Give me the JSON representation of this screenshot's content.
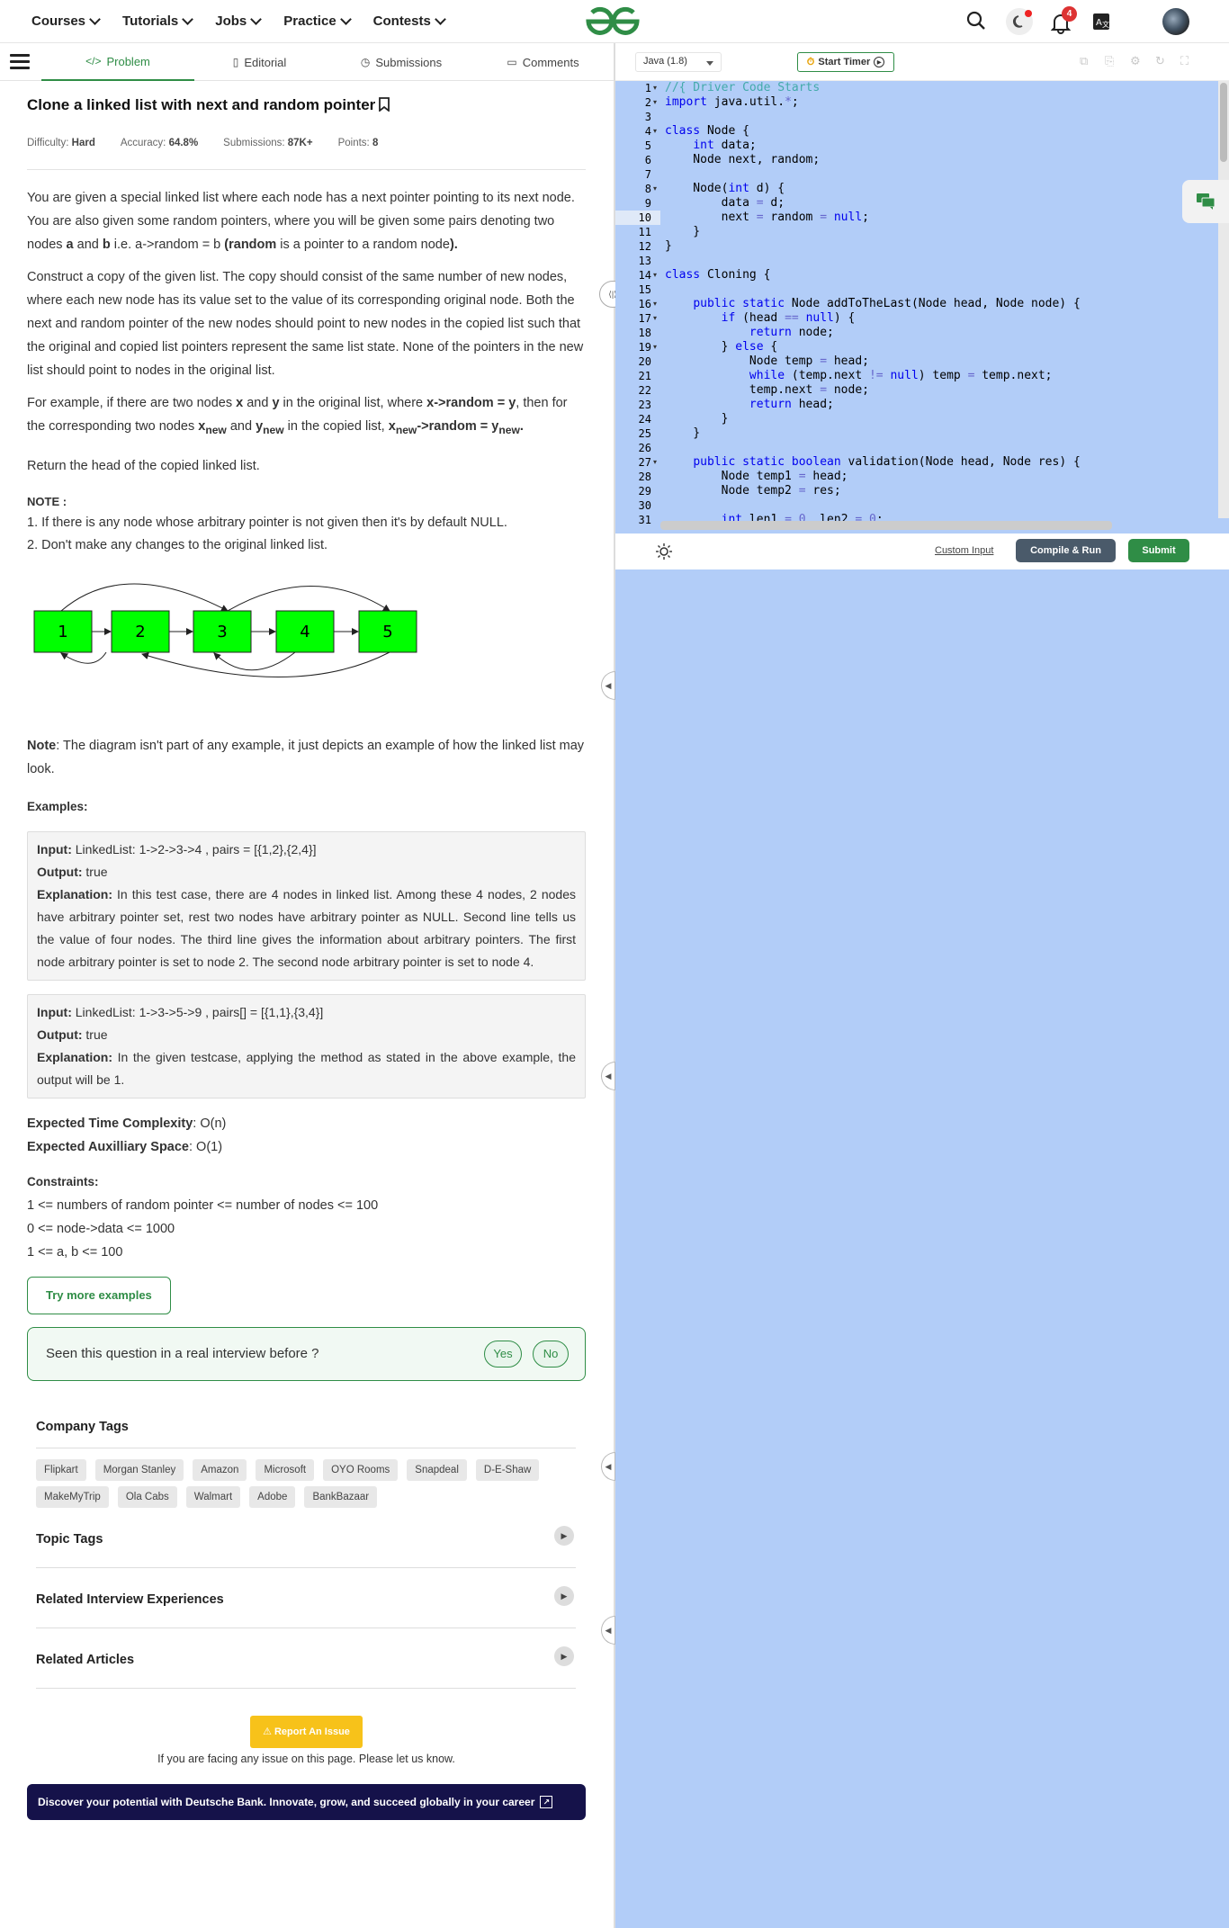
{
  "nav": {
    "items": [
      "Courses",
      "Tutorials",
      "Jobs",
      "Practice",
      "Contests"
    ],
    "logo_text": "GfG",
    "notifications": "4"
  },
  "tabs": {
    "problem": "Problem",
    "editorial": "Editorial",
    "submissions": "Submissions",
    "comments": "Comments"
  },
  "problem": {
    "title": "Clone a linked list with next and random pointer",
    "difficulty_label": "Difficulty:",
    "difficulty": "Hard",
    "accuracy_label": "Accuracy:",
    "accuracy": "64.8%",
    "submissions_label": "Submissions:",
    "submissions": "87K+",
    "points_label": "Points:",
    "points": "8",
    "p1a": "You are given a special linked list where each node has a next pointer pointing to its next node. You are also given some random pointers, where you will be given some pairs denoting two nodes ",
    "p1b": "a",
    "p1c": " and ",
    "p1d": "b",
    "p1e": " i.e. a->random = b ",
    "p1f": "(random",
    "p1g": " is a pointer to a random node",
    "p1h": ").",
    "p2": "Construct a copy of the given list. The copy should consist of the same number of new nodes, where each new node has its value set to the value of its corresponding original node. Both the next and random pointer of the new nodes should point to new nodes in the copied list such that the original and copied list pointers represent the same list state. None of the pointers in the new list should point to nodes in the original list.",
    "p3a": "For example, if there are two nodes ",
    "p3b": "x",
    "p3c": " and ",
    "p3d": "y",
    "p3e": " in the original list, where ",
    "p3f": "x->random = y",
    "p3g": ", then for the corresponding two nodes ",
    "p3h": "x",
    "p3i": "new",
    "p3j": " and ",
    "p3k": "y",
    "p3l": "new",
    "p3m": " in the copied list, ",
    "p3n": "x",
    "p3o": "new",
    "p3p": "->random = y",
    "p3q": "new",
    "p3r": ".",
    "p4": "Return the head of the copied linked list.",
    "note_title": "NOTE :",
    "note1": "1. If there is any node whose arbitrary pointer is not given then it's by default NULL.",
    "note2": "2. Don't make any changes to the original linked list.",
    "diagram_nodes": [
      "1",
      "2",
      "3",
      "4",
      "5"
    ],
    "diagram_note_label": "Note",
    "diagram_note": ": The diagram isn't part of any example, it just depicts an example of how the linked list may look.",
    "examples_label": "Examples:",
    "ex1_input_label": "Input:",
    "ex1_input": " LinkedList:  1->2->3->4  ,  pairs  =  [{1,2},{2,4}]",
    "ex1_output_label": "Output:",
    "ex1_output": " true",
    "ex1_expl_label": "Explanation:",
    "ex1_expl": " In this test case, there are 4 nodes in linked list.  Among these 4 nodes,  2 nodes have arbitrary pointer set, rest two nodes have arbitrary pointer as NULL. Second line tells us the value of four nodes. The third line gives the information about arbitrary pointers. The first node arbitrary pointer is set to node 2.  The second node arbitrary pointer is set to node 4.",
    "ex2_input_label": "Input:",
    "ex2_input": " LinkedList:  1->3->5->9  ,  pairs[]  =  [{1,1},{3,4}]",
    "ex2_output_label": "Output:",
    "ex2_output": " true",
    "ex2_expl_label": "Explanation:",
    "ex2_expl": " In the given testcase, applying the method as stated in the above example, the output will be 1.",
    "etc_label": "Expected Time Complexity",
    "etc": ": O(n)",
    "eas_label": "Expected Auxilliary Space",
    "eas": ": O(1)",
    "constraints_label": "Constraints:",
    "c1": "1 <= numbers of random pointer <= number of nodes <= 100",
    "c2": "0 <= node->data <= 1000",
    "c3": "1 <= a, b <= 100",
    "try_more": "Try more examples",
    "seen_q": "Seen this question in a real interview before ?",
    "yes": "Yes",
    "no": "No",
    "company_tags_label": "Company Tags",
    "company_tags": [
      "Flipkart",
      "Morgan Stanley",
      "Amazon",
      "Microsoft",
      "OYO Rooms",
      "Snapdeal",
      "D-E-Shaw",
      "MakeMyTrip",
      "Ola Cabs",
      "Walmart",
      "Adobe",
      "BankBazaar"
    ],
    "topic_tags": "Topic Tags",
    "related_interview": "Related Interview Experiences",
    "related_articles": "Related Articles",
    "report": "Report An Issue",
    "report_note": "If you are facing any issue on this page. Please let us know.",
    "banner": "Discover your potential with Deutsche Bank. Innovate, grow, and succeed globally in your career"
  },
  "editor": {
    "language": "Java (1.8)",
    "start_timer": "Start Timer",
    "custom_input": "Custom Input",
    "compile_run": "Compile & Run",
    "submit": "Submit",
    "current_line": 10
  }
}
